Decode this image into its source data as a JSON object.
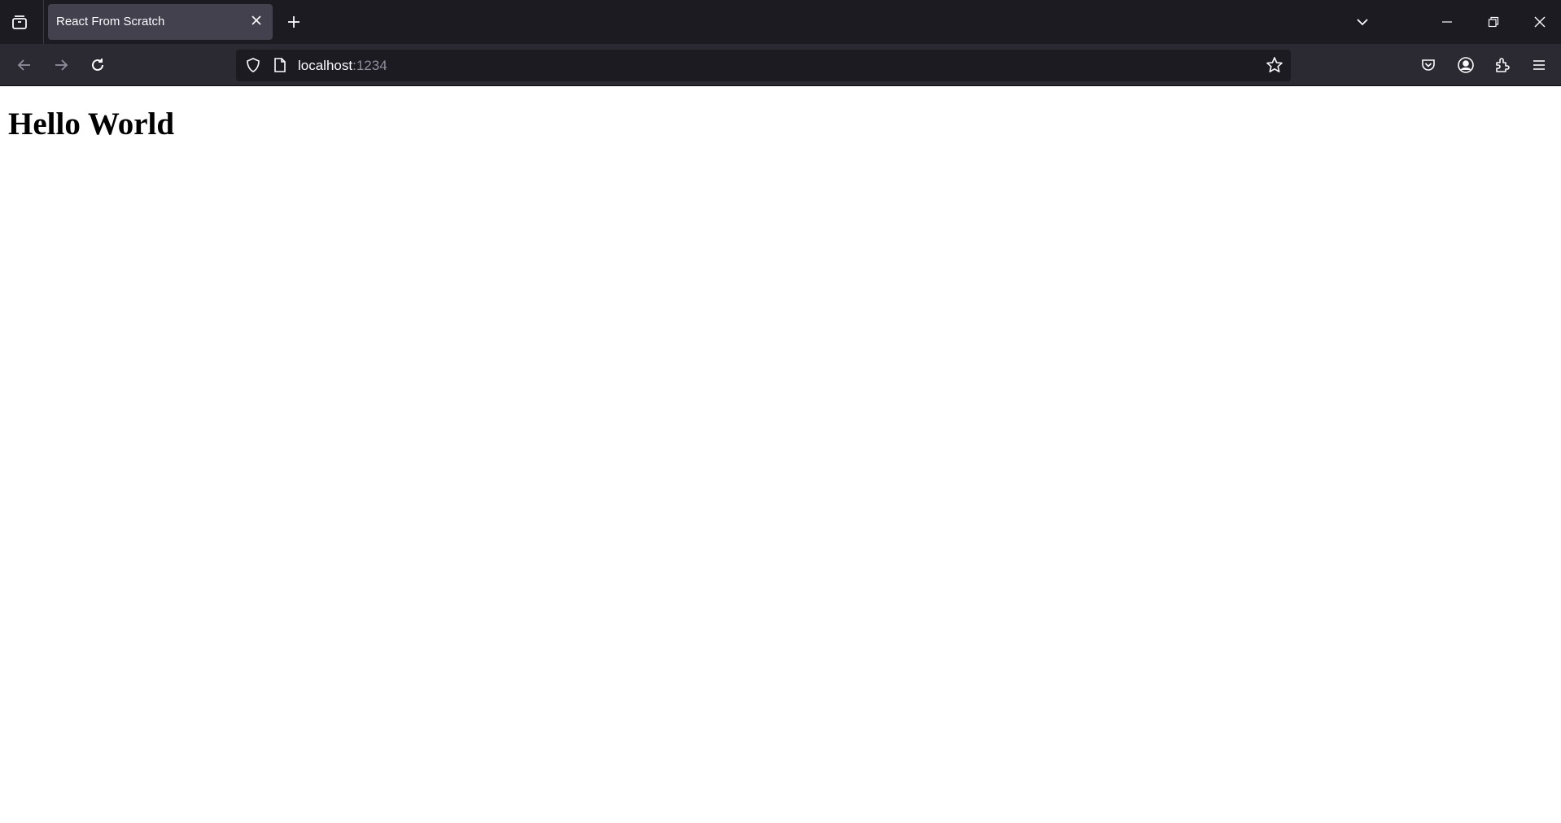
{
  "browser": {
    "tabs": [
      {
        "title": "React From Scratch",
        "active": true,
        "close_icon": "close-icon"
      }
    ],
    "tab_strip": {
      "tab_list_icon": "tab-list-icon",
      "new_tab_icon": "plus-icon",
      "list_all_tabs_icon": "chevron-down-icon",
      "window_controls": [
        "minimize-icon",
        "restore-icon",
        "close-icon"
      ]
    },
    "toolbar": {
      "back_icon": "arrow-left-icon",
      "forward_icon": "arrow-right-icon",
      "reload_icon": "reload-icon",
      "urlbar": {
        "host": "localhost",
        "port": ":1234",
        "security_icon": "shield-icon",
        "page_icon": "page-icon",
        "bookmark_icon": "star-icon"
      },
      "right_icons": [
        "pocket-icon",
        "account-icon",
        "extensions-icon",
        "hamburger-menu-icon"
      ]
    },
    "colors": {
      "tabstrip_bg": "#1c1b22",
      "toolbar_bg": "#2b2a33",
      "active_tab_bg": "#42414d",
      "urlbar_bg": "#1c1b22",
      "text_light": "#fbfbfe",
      "text_dim": "#8f8f9d"
    }
  },
  "page": {
    "heading": "Hello World"
  }
}
